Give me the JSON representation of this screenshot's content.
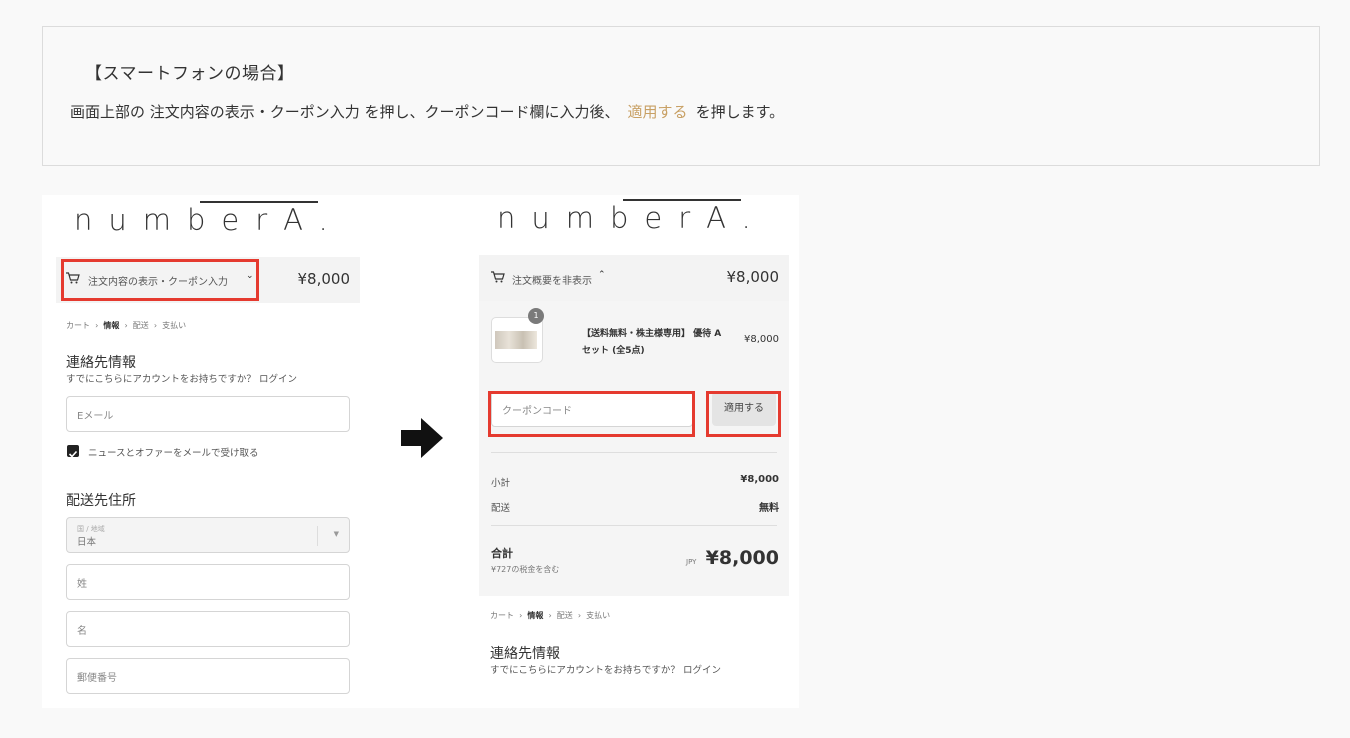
{
  "notice": {
    "heading": "【スマートフォンの場合】",
    "text_before": "画面上部の 注文内容の表示・クーポン入力 を押し、クーポンコード欄に入力後、",
    "link": "適用する",
    "text_after": "を押します。"
  },
  "left": {
    "logo": "numberA.",
    "summary_toggle": "注文内容の表示・クーポン入力",
    "price": "¥8,000",
    "breadcrumb": [
      "カート",
      "情報",
      "配送",
      "支払い"
    ],
    "contact_title": "連絡先情報",
    "account_prompt": "すでにこちらにアカウントをお持ちですか？",
    "login": "ログイン",
    "email_placeholder": "Eメール",
    "newsletter": "ニュースとオファーをメールで受け取る",
    "shipping_title": "配送先住所",
    "country_label": "国 / 地域",
    "country_value": "日本",
    "last_name": "姓",
    "first_name": "名",
    "postal_code": "郵便番号"
  },
  "right": {
    "logo": "numberA.",
    "summary_toggle": "注文概要を非表示",
    "price": "¥8,000",
    "item_qty": "1",
    "item_name_line1": "【送料無料・株主様専用】 優待 A",
    "item_name_line2": "セット (全5点)",
    "item_price": "¥8,000",
    "coupon_placeholder": "クーポンコード",
    "apply_button": "適用する",
    "subtotal_label": "小計",
    "subtotal_value": "¥8,000",
    "shipping_label": "配送",
    "shipping_value": "無料",
    "total_label": "合計",
    "tax_note": "¥727の税金を含む",
    "currency": "JPY",
    "total_value": "¥8,000",
    "breadcrumb": [
      "カート",
      "情報",
      "配送",
      "支払い"
    ],
    "contact_title": "連絡先情報",
    "account_prompt": "すでにこちらにアカウントをお持ちですか？",
    "login": "ログイン"
  },
  "colors": {
    "highlight": "#e53a2f",
    "link": "#c8a064"
  }
}
